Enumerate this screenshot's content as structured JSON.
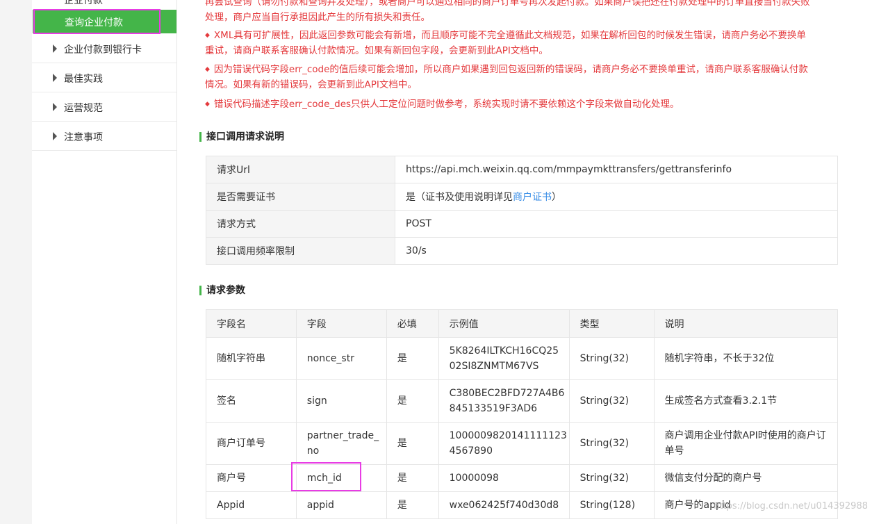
{
  "sidebar": {
    "cut_item": "企业付款",
    "active_item": "查询企业付款",
    "items": [
      {
        "label": "企业付款到银行卡"
      },
      {
        "label": "最佳实践"
      },
      {
        "label": "运营规范"
      },
      {
        "label": "注意事项"
      }
    ]
  },
  "notes": {
    "line0a": "再尝试查询（请勿付款和查询并发处理），或者商户可以通过相同的商户订单号再次发起付款。如果商户误把还在付款处理中的订单直接当付款失败",
    "line0b": "处理，商户应当自行承担因此产生的所有损失和责任。",
    "line1a": "XML具有可扩展性，因此返回参数可能会有新增，而且顺序可能不完全遵循此文档规范，如果在解析回包的时候发生错误，请商户务必不要换单",
    "line1b": "重试，请商户联系客服确认付款情况。如果有新回包字段，会更新到此API文档中。",
    "line2a": "因为错误代码字段err_code的值后续可能会增加，所以商户如果遇到回包返回新的错误码，请商户务必不要换单重试，请商户联系客服确认付款",
    "line2b": "情况。如果有新的错误码，会更新到此API文档中。",
    "line3": "错误代码描述字段err_code_des只供人工定位问题时做参考，系统实现时请不要依赖这个字段来做自动化处理。"
  },
  "request": {
    "title": "接口调用请求说明",
    "rows": [
      {
        "key": "请求Url",
        "value": "https://api.mch.weixin.qq.com/mmpaymkttransfers/gettransferinfo"
      },
      {
        "key": "是否需要证书",
        "value_pre": "是（证书及使用说明详见",
        "value_link": "商户证书",
        "value_post": "）"
      },
      {
        "key": "请求方式",
        "value": "POST"
      },
      {
        "key": "接口调用频率限制",
        "value": "30/s"
      }
    ]
  },
  "params": {
    "title": "请求参数",
    "headers": [
      "字段名",
      "字段",
      "必填",
      "示例值",
      "类型",
      "说明"
    ],
    "rows": [
      {
        "name": "随机字符串",
        "field": "nonce_str",
        "required": "是",
        "example": "5K8264ILTKCH16CQ2502SI8ZNMTM67VS",
        "example_l1": "5K8264ILTKCH16CQ25",
        "example_l2": "02SI8ZNMTM67VS",
        "type": "String(32)",
        "desc": "随机字符串，不长于32位"
      },
      {
        "name": "签名",
        "field": "sign",
        "required": "是",
        "example_l1": "C380BEC2BFD727A4B6",
        "example_l2": "845133519F3AD6",
        "type": "String(32)",
        "desc": "生成签名方式查看3.2.1节"
      },
      {
        "name": "商户订单号",
        "field_l1": "partner_trade_",
        "field_l2": "no",
        "required": "是",
        "example_l1": "1000009820141111123",
        "example_l2": "4567890",
        "type": "String(32)",
        "desc_l1": "商户调用企业付款API时使用的商户订",
        "desc_l2": "单号"
      },
      {
        "name": "商户号",
        "field": "mch_id",
        "required": "是",
        "example": "10000098",
        "type": "String(32)",
        "desc": "微信支付分配的商户号"
      },
      {
        "name": "Appid",
        "field": "appid",
        "required": "是",
        "example": "wxe062425f740d30d8",
        "type": "String(128)",
        "desc": "商户号的appid"
      }
    ]
  },
  "watermark": "https://blog.csdn.net/u014392988",
  "colors": {
    "accent": "#44b549",
    "highlight": "#e83ce4",
    "warning": "#e4393c",
    "link": "#3a8ee6"
  }
}
